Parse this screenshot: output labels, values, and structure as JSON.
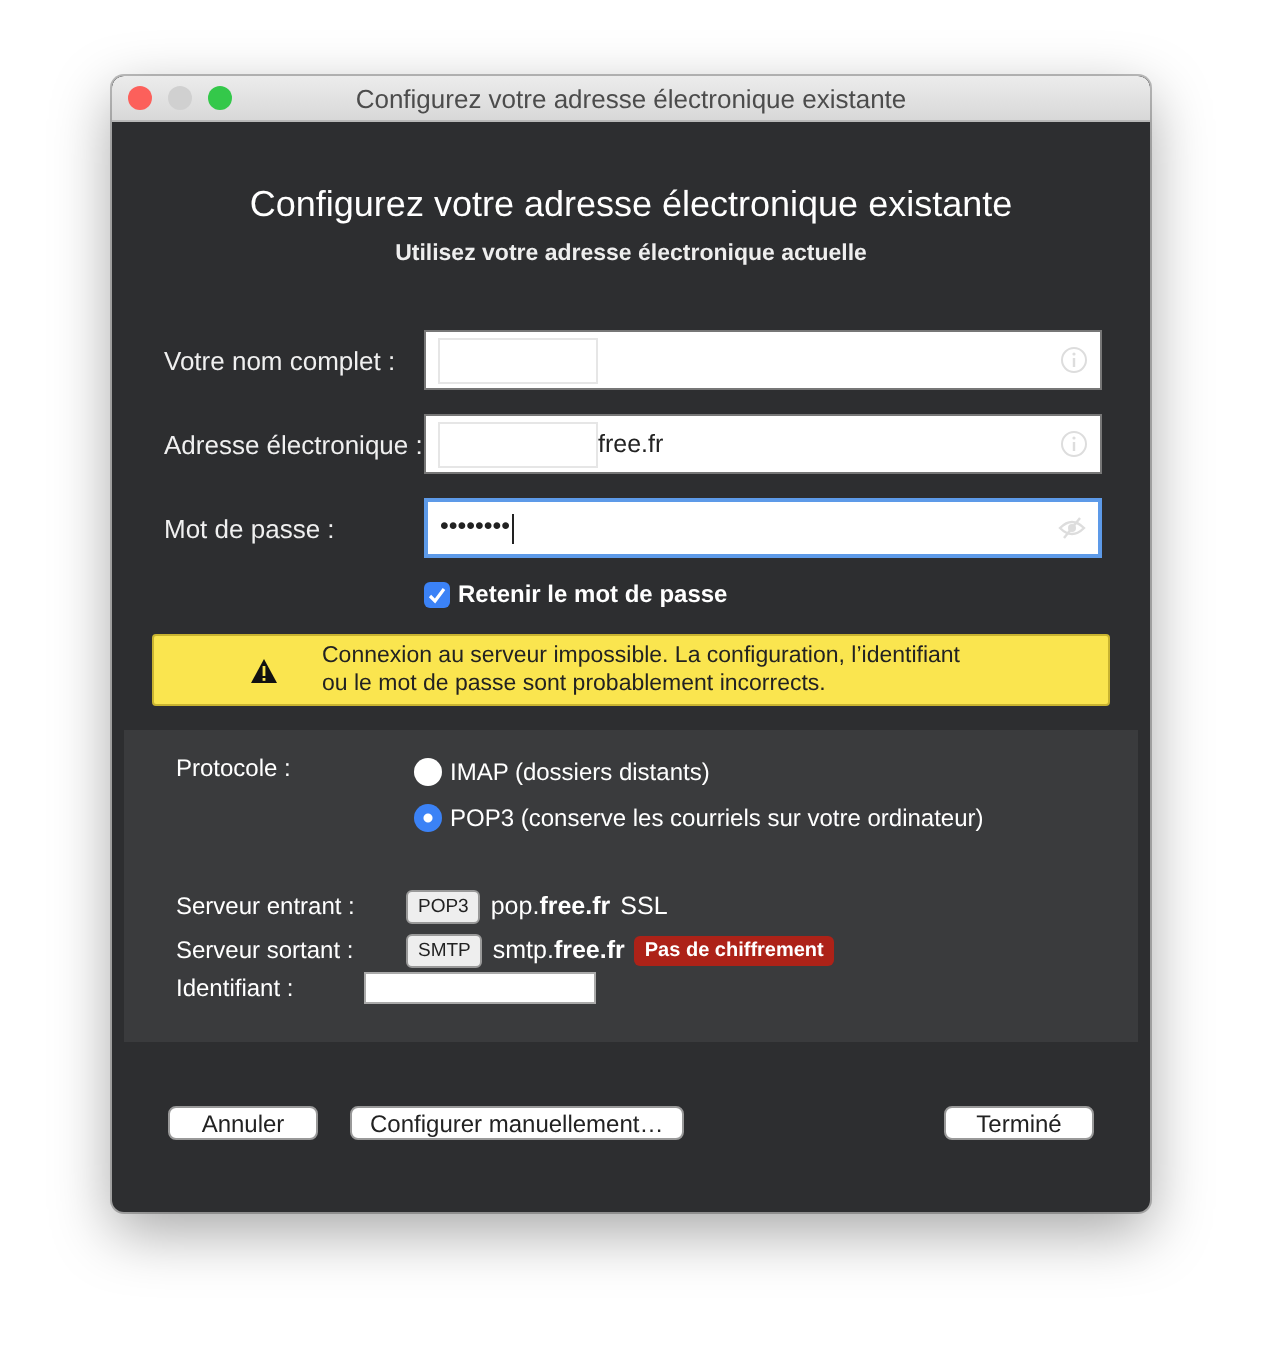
{
  "window": {
    "title": "Configurez votre adresse électronique existante"
  },
  "heading": "Configurez votre adresse électronique existante",
  "subheading": "Utilisez votre adresse électronique actuelle",
  "fields": [
    {
      "label": "Votre nom complet :",
      "kind": "text",
      "redacted": true,
      "focused": false
    },
    {
      "label": "Adresse électronique :",
      "kind": "text",
      "value": "free.fr",
      "redacted": true,
      "focused": false
    },
    {
      "label": "Mot de passe :",
      "kind": "password",
      "masked_text": "••••••••",
      "redacted": false,
      "focused": true
    }
  ],
  "remember": {
    "label": "Retenir le mot de passe",
    "checked": true
  },
  "warning": {
    "text": "Connexion au serveur impossible. La configuration, l’identifiant\nou le mot de passe sont probablement incorrects."
  },
  "protocol": {
    "label": "Protocole :",
    "options": [
      {
        "label": "IMAP (dossiers distants)",
        "selected": false
      },
      {
        "label": "POP3 (conserve les courriels sur votre ordinateur)",
        "selected": true
      }
    ]
  },
  "servers": [
    {
      "label": "Serveur entrant :",
      "badge": "POP3",
      "host": "pop.**free.fr**",
      "security": "SSL",
      "security_alert": false
    },
    {
      "label": "Serveur sortant :",
      "badge": "SMTP",
      "host": "smtp.**free.fr**",
      "security": "Pas de chiffrement",
      "security_alert": true
    }
  ],
  "username": {
    "label": "Identifiant :"
  },
  "buttons": [
    {
      "label": "Annuler",
      "kind": "left"
    },
    {
      "label": "Configurer manuellement…",
      "kind": "left"
    },
    {
      "label": "Terminé",
      "kind": "right"
    }
  ]
}
